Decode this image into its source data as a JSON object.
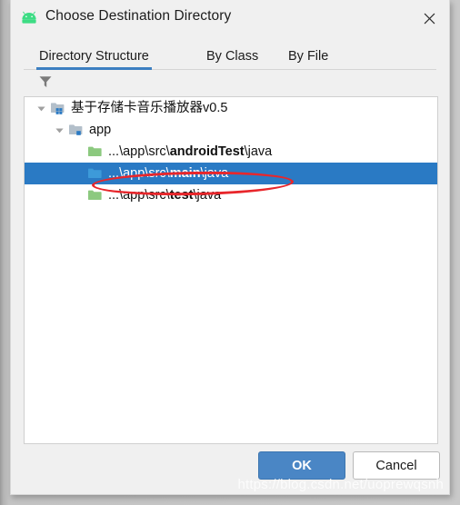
{
  "window": {
    "title": "Choose Destination Directory",
    "app_icon": "android-robot-icon",
    "close_icon": "close-icon"
  },
  "tabs": [
    {
      "label": "Directory Structure",
      "active": true
    },
    {
      "label": "By Class",
      "active": false
    },
    {
      "label": "By File",
      "active": false
    }
  ],
  "filter": {
    "icon": "filter-funnel-icon"
  },
  "tree": {
    "rows": [
      {
        "label": "基于存储卡音乐播放器v0.5",
        "label_bold": "",
        "label_tail": "",
        "icon": "module-folder-icon",
        "twisty": "chevron-down-icon",
        "level": 0,
        "selected": false
      },
      {
        "label": "app",
        "label_bold": "",
        "label_tail": "",
        "icon": "module-folder-icon",
        "twisty": "chevron-down-icon",
        "level": 1,
        "selected": false
      },
      {
        "label": "...\\app\\src\\",
        "label_bold": "androidTest",
        "label_tail": "\\java",
        "icon": "green-source-folder-icon",
        "twisty": "",
        "level": 2,
        "selected": false
      },
      {
        "label": "...\\app\\src\\",
        "label_bold": "main",
        "label_tail": "\\java",
        "icon": "blue-source-folder-icon",
        "twisty": "",
        "level": 2,
        "selected": true
      },
      {
        "label": "...\\app\\src\\",
        "label_bold": "test",
        "label_tail": "\\java",
        "icon": "green-source-folder-icon",
        "twisty": "",
        "level": 2,
        "selected": false
      }
    ]
  },
  "annotation": {
    "shape": "red-ellipse-highlight"
  },
  "footer": {
    "ok_label": "OK",
    "cancel_label": "Cancel"
  },
  "watermark": {
    "text": "https://blog.csdn.net/uoprewqsnh"
  },
  "colors": {
    "accent": "#3c7fc1",
    "selection": "#2a7ac4",
    "ok_button": "#4a86c5",
    "annotation": "#e8262b",
    "android_green": "#3ddc84",
    "source_folder_green": "#8cc97f",
    "source_folder_blue": "#3d9ad9"
  }
}
